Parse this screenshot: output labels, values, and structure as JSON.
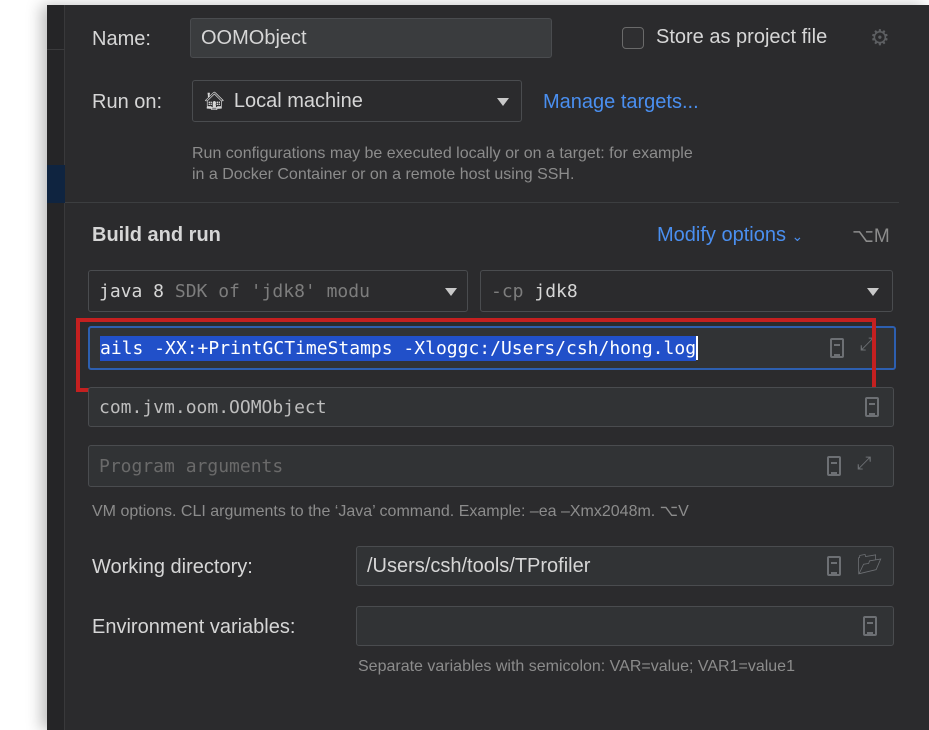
{
  "name": {
    "label": "Name:",
    "value": "OOMObject"
  },
  "store_project": {
    "label": "Store as project file",
    "checked": false
  },
  "run_on": {
    "label": "Run on:",
    "value": "Local machine",
    "manage_link": "Manage targets...",
    "hint_line1": "Run configurations may be executed locally or on a target: for example",
    "hint_line2": "in a Docker Container or on a remote host using SSH."
  },
  "build": {
    "title": "Build and run",
    "modify_options": "Modify options",
    "modify_shortcut": "⌥M"
  },
  "jre": {
    "prefix": "java 8",
    "suffix": "SDK of 'jdk8' modu"
  },
  "classpath": {
    "prefix": "-cp",
    "value": "jdk8"
  },
  "vm_options": {
    "value": "ails -XX:+PrintGCTimeStamps -Xloggc:/Users/csh/hong.log",
    "hint": "VM options. CLI arguments to the ‘Java’ command. Example: –ea –Xmx2048m. ⌥V"
  },
  "main_class": {
    "value": "com.jvm.oom.OOMObject"
  },
  "program_args": {
    "placeholder": "Program arguments"
  },
  "working_dir": {
    "label": "Working directory:",
    "value": "/Users/csh/tools/TProfiler"
  },
  "env_vars": {
    "label": "Environment variables:",
    "value": "",
    "hint": "Separate variables with semicolon: VAR=value; VAR1=value1"
  },
  "colors": {
    "accent": "#4a8ff0",
    "selection": "#2150c9",
    "highlight_box": "#c42020",
    "background": "#2b2b2d"
  }
}
